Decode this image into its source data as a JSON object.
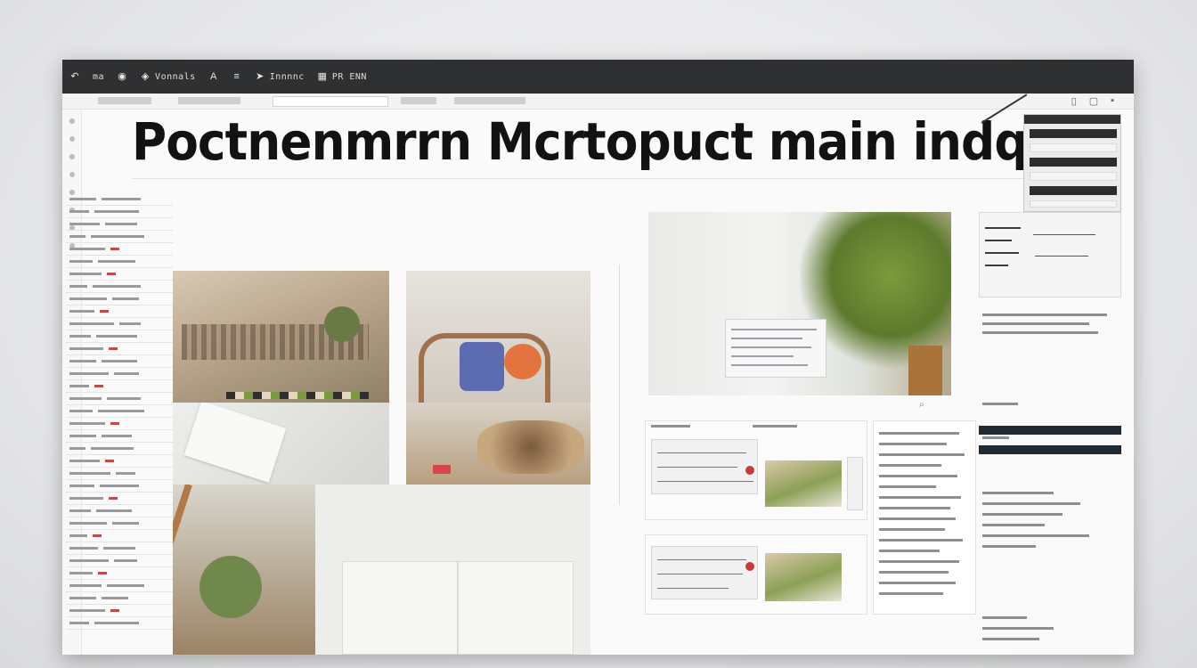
{
  "window": {
    "headline": "Poctnenmrrn Mcrtopuct main indque"
  },
  "toolbar": {
    "items": [
      {
        "label": "",
        "icon": "undo-icon"
      },
      {
        "label": "ma",
        "icon": ""
      },
      {
        "label": "",
        "icon": "record-icon"
      },
      {
        "label": "Vonnals",
        "icon": "layers-icon"
      },
      {
        "label": "",
        "icon": "text-icon"
      },
      {
        "label": "",
        "icon": "align-icon"
      },
      {
        "label": "Innnnc",
        "icon": "arrow-icon"
      },
      {
        "label": "PR ENN",
        "icon": "grid-icon"
      }
    ]
  },
  "colors": {
    "titlebar": "#2f3032",
    "accent_red": "#c24a4a",
    "dark_list": "#1f2a33"
  }
}
